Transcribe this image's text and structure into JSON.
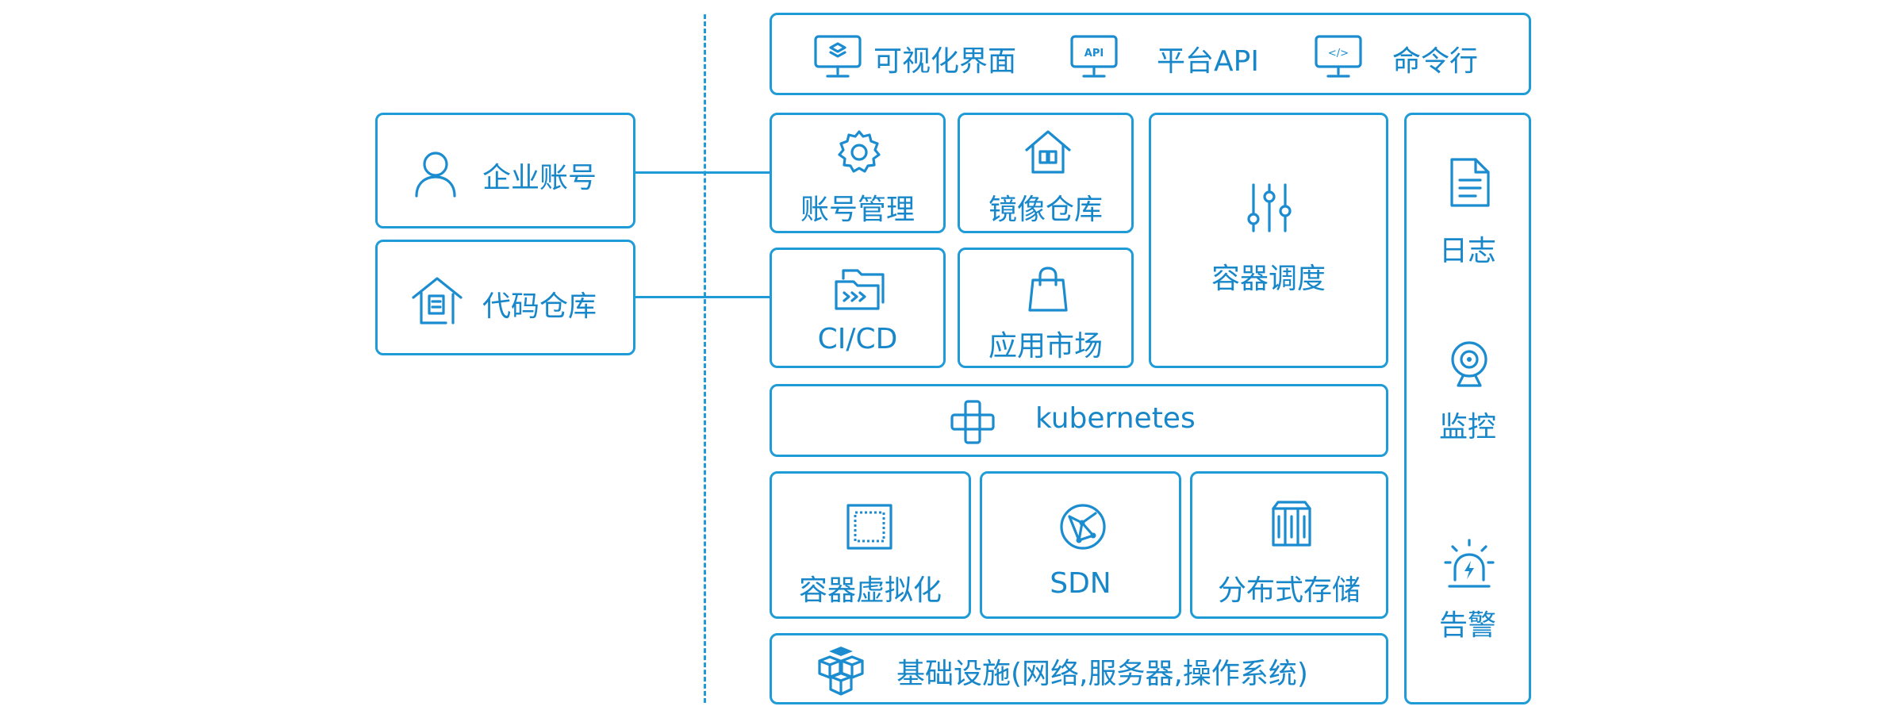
{
  "top_bar": {
    "visual_ui": "可视化界面",
    "platform_api": "平台API",
    "cli": "命令行",
    "api_badge": "API",
    "code_badge": "</>"
  },
  "left": {
    "enterprise_account": "企业账号",
    "code_repo": "代码仓库"
  },
  "modules": {
    "account_mgmt": "账号管理",
    "image_repo": "镜像仓库",
    "container_sched": "容器调度",
    "cicd": "CI/CD",
    "app_market": "应用市场",
    "kubernetes": "kubernetes",
    "container_virt": "容器虚拟化",
    "sdn": "SDN",
    "dist_storage": "分布式存储",
    "infrastructure": "基础设施(网络,服务器,操作系统)"
  },
  "side": {
    "log": "日志",
    "monitor": "监控",
    "alert": "告警"
  },
  "colors": {
    "accent": "#1f9bd7",
    "text": "#1787c9"
  }
}
